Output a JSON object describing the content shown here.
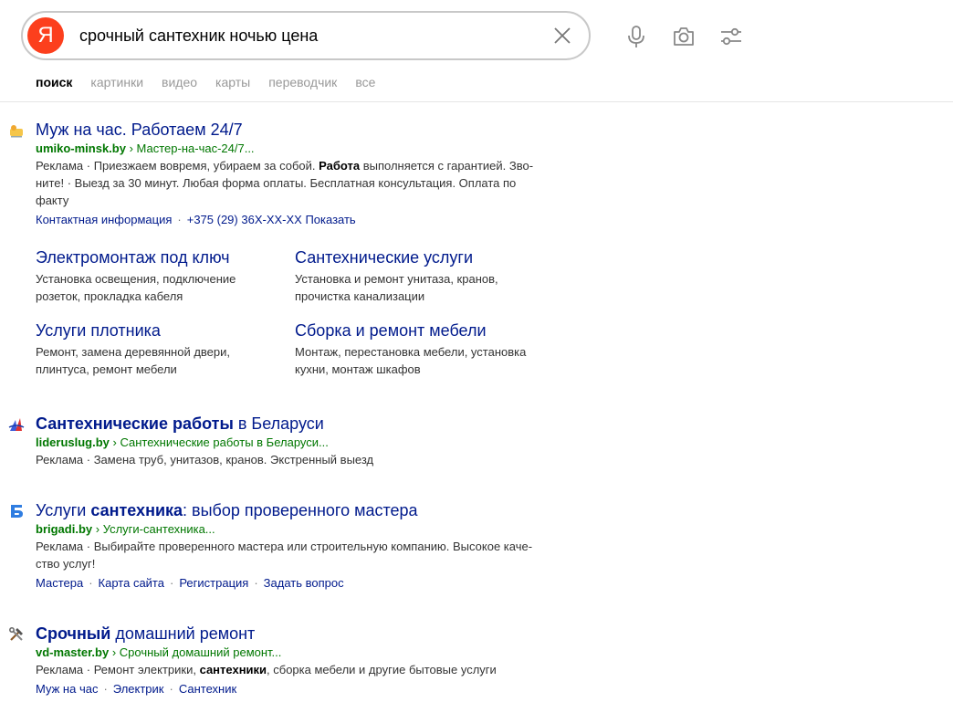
{
  "search": {
    "logo_letter": "Я",
    "query": "срочный сантехник ночью цена"
  },
  "tabs": [
    {
      "label": "поиск",
      "active": true
    },
    {
      "label": "картинки"
    },
    {
      "label": "видео"
    },
    {
      "label": "карты"
    },
    {
      "label": "переводчик"
    },
    {
      "label": "все"
    }
  ],
  "results": [
    {
      "title": "Муж на час. Работаем 24/7",
      "url_domain": "umiko-minsk.by",
      "url_path": "› Мастер-на-час-24/7...",
      "snippet_prefix": "Реклама · Приезжаем вовремя, убираем за собой. ",
      "snippet_bold": "Работа",
      "snippet_line1_rest": " выполняется с гарантией. Зво-",
      "snippet_line2": "ните! · Выезд за 30 минут. Любая форма оплаты. Бесплатная консультация. Оплата по",
      "snippet_line3": "факту",
      "contact_link": "Контактная информация",
      "phone_link": "+375 (29) 36Х-ХХ-ХХ Показать",
      "sitelinks": [
        {
          "title": "Электромонтаж под ключ",
          "desc": "Установка освещения, подключение розеток, прокладка кабеля"
        },
        {
          "title": "Сантехнические услуги",
          "desc": "Установка и ремонт унитаза, кранов, прочистка канализации"
        },
        {
          "title": "Услуги плотника",
          "desc": "Ремонт, замена деревянной двери, плинтуса, ремонт мебели"
        },
        {
          "title": "Сборка и ремонт мебели",
          "desc": "Монтаж, перестановка мебели, установка кухни, монтаж шкафов"
        }
      ]
    },
    {
      "title_bold": "Сантехнические работы",
      "title_rest": " в Беларуси",
      "url_domain": "lideruslug.by",
      "url_path": "› Сантехнические работы в Беларуси...",
      "snippet": "Реклама · Замена труб, унитазов, кранов. Экстренный выезд"
    },
    {
      "title_pre": "Услуги ",
      "title_bold": "сантехника",
      "title_rest": ": выбор проверенного мастера",
      "url_domain": "brigadi.by",
      "url_path": "› Услуги-сантехника...",
      "snippet_line1": "Реклама · Выбирайте проверенного мастера или строительную компанию. Высокое каче-",
      "snippet_line2": "ство услуг!",
      "links": [
        "Мастера",
        "Карта сайта",
        "Регистрация",
        "Задать вопрос"
      ]
    },
    {
      "title_bold": "Срочный",
      "title_rest": " домашний ремонт",
      "url_domain": "vd-master.by",
      "url_path": "› Срочный домашний ремонт...",
      "snippet_pre": "Реклама · Ремонт электрики, ",
      "snippet_bold": "сантехники",
      "snippet_rest": ", сборка мебели и другие бытовые услуги",
      "links": [
        "Муж на час",
        "Электрик",
        "Сантехник"
      ]
    }
  ],
  "colors": {
    "logo": "#fc3f1d",
    "link": "#001a8c",
    "url": "#007700"
  }
}
